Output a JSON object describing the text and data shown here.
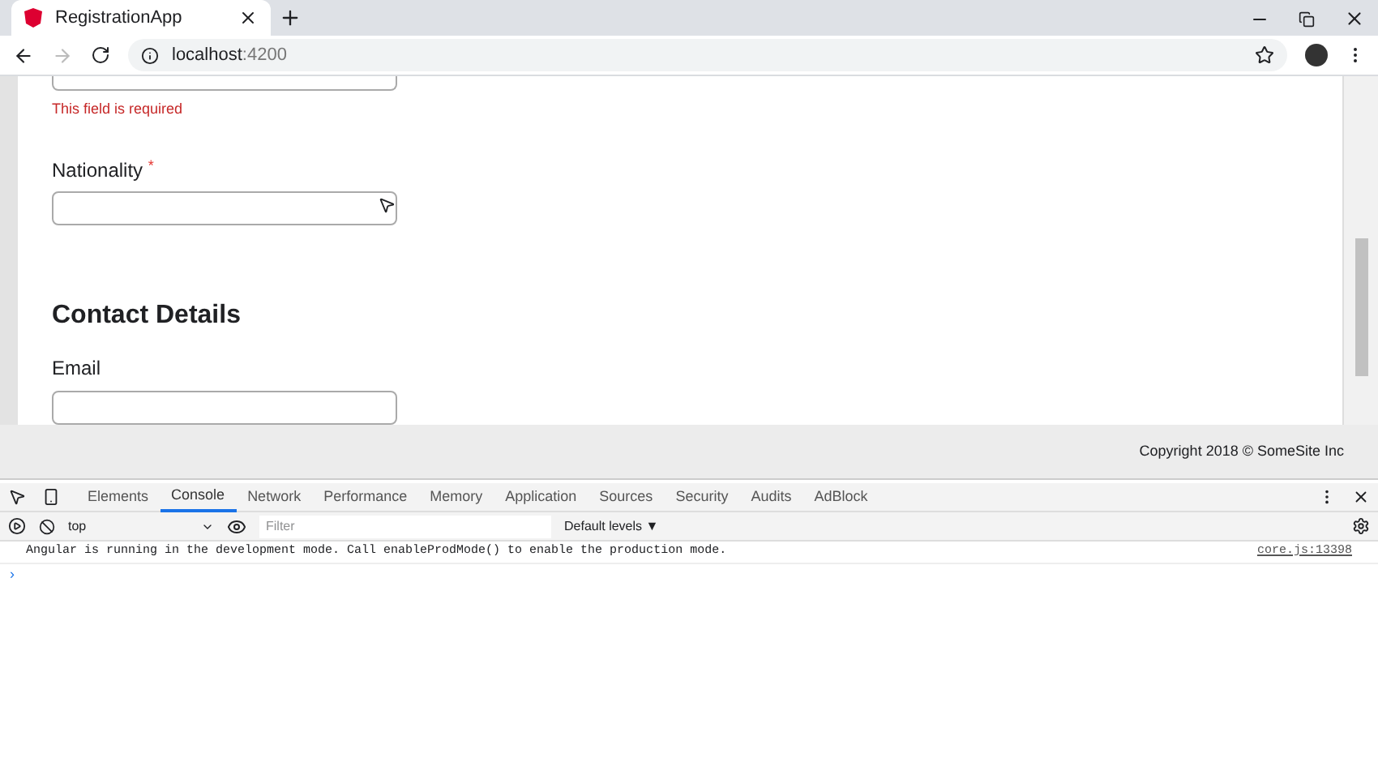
{
  "browser_tab": {
    "title": "RegistrationApp",
    "selected": true
  },
  "address_bar": {
    "host": "localhost",
    "port": ":4200"
  },
  "form": {
    "date_error": "This field is required",
    "nationality": {
      "label": "Nationality",
      "required_mark": "*"
    },
    "section_title": "Contact Details",
    "email": {
      "label": "Email"
    }
  },
  "footer": "Copyright 2018 © SomeSite Inc",
  "devtools": {
    "tabs": [
      {
        "label": "Elements",
        "selected": false
      },
      {
        "label": "Console",
        "selected": true
      },
      {
        "label": "Network",
        "selected": false
      },
      {
        "label": "Performance",
        "selected": false
      },
      {
        "label": "Memory",
        "selected": false
      },
      {
        "label": "Application",
        "selected": false
      },
      {
        "label": "Sources",
        "selected": false
      },
      {
        "label": "Security",
        "selected": false
      },
      {
        "label": "Audits",
        "selected": false
      },
      {
        "label": "AdBlock",
        "selected": false
      }
    ],
    "context": "top",
    "filter_placeholder": "Filter",
    "levels": "Default levels ▼",
    "messages": [
      {
        "text": "Angular is running in the development mode. Call enableProdMode() to enable the production mode.",
        "source": "core.js:13398"
      }
    ],
    "prompt": "›"
  }
}
